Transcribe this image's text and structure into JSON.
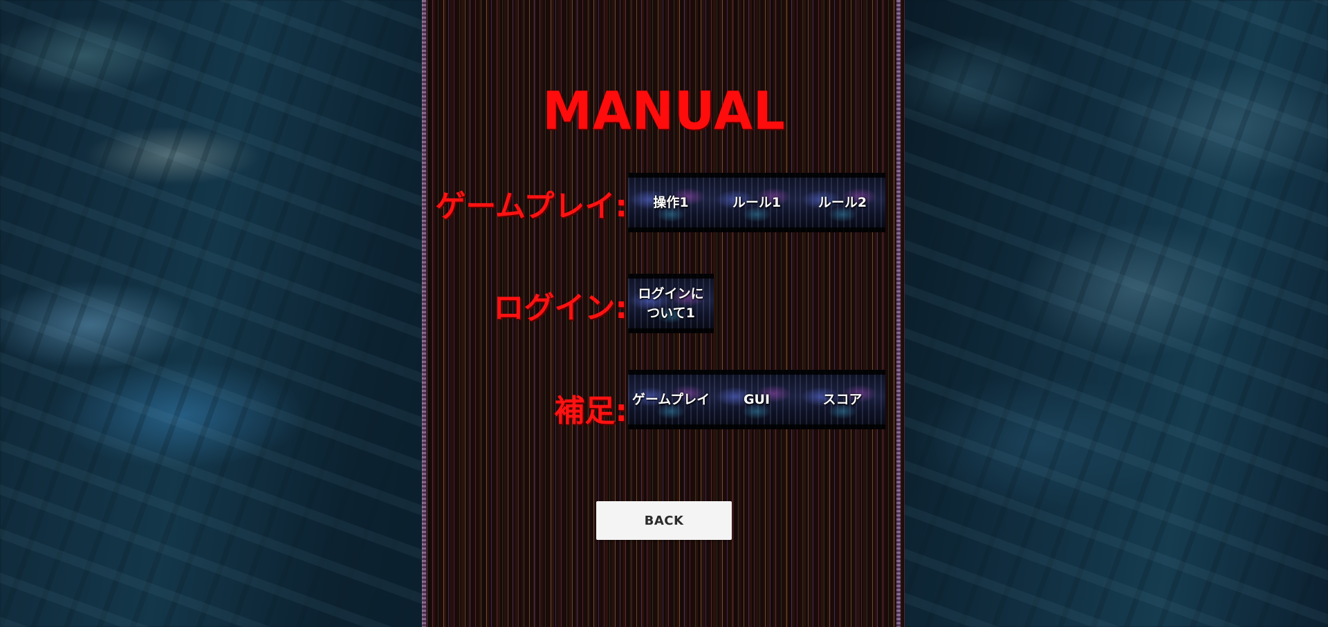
{
  "title": "MANUAL",
  "sections": [
    {
      "label": "ゲームプレイ:",
      "buttons": [
        "操作1",
        "ルール1",
        "ルール2"
      ]
    },
    {
      "label": "ログイン:",
      "buttons": [
        "ログインに\nついて1"
      ]
    },
    {
      "label": "補足:",
      "buttons": [
        "ゲームプレイ",
        "GUI",
        "スコア"
      ]
    }
  ],
  "back_label": "BACK",
  "colors": {
    "title": "#ff0d0d",
    "section_label": "#ff1212",
    "back_button_bg": "#f4f4f4",
    "back_button_text": "#2b2b2b"
  }
}
